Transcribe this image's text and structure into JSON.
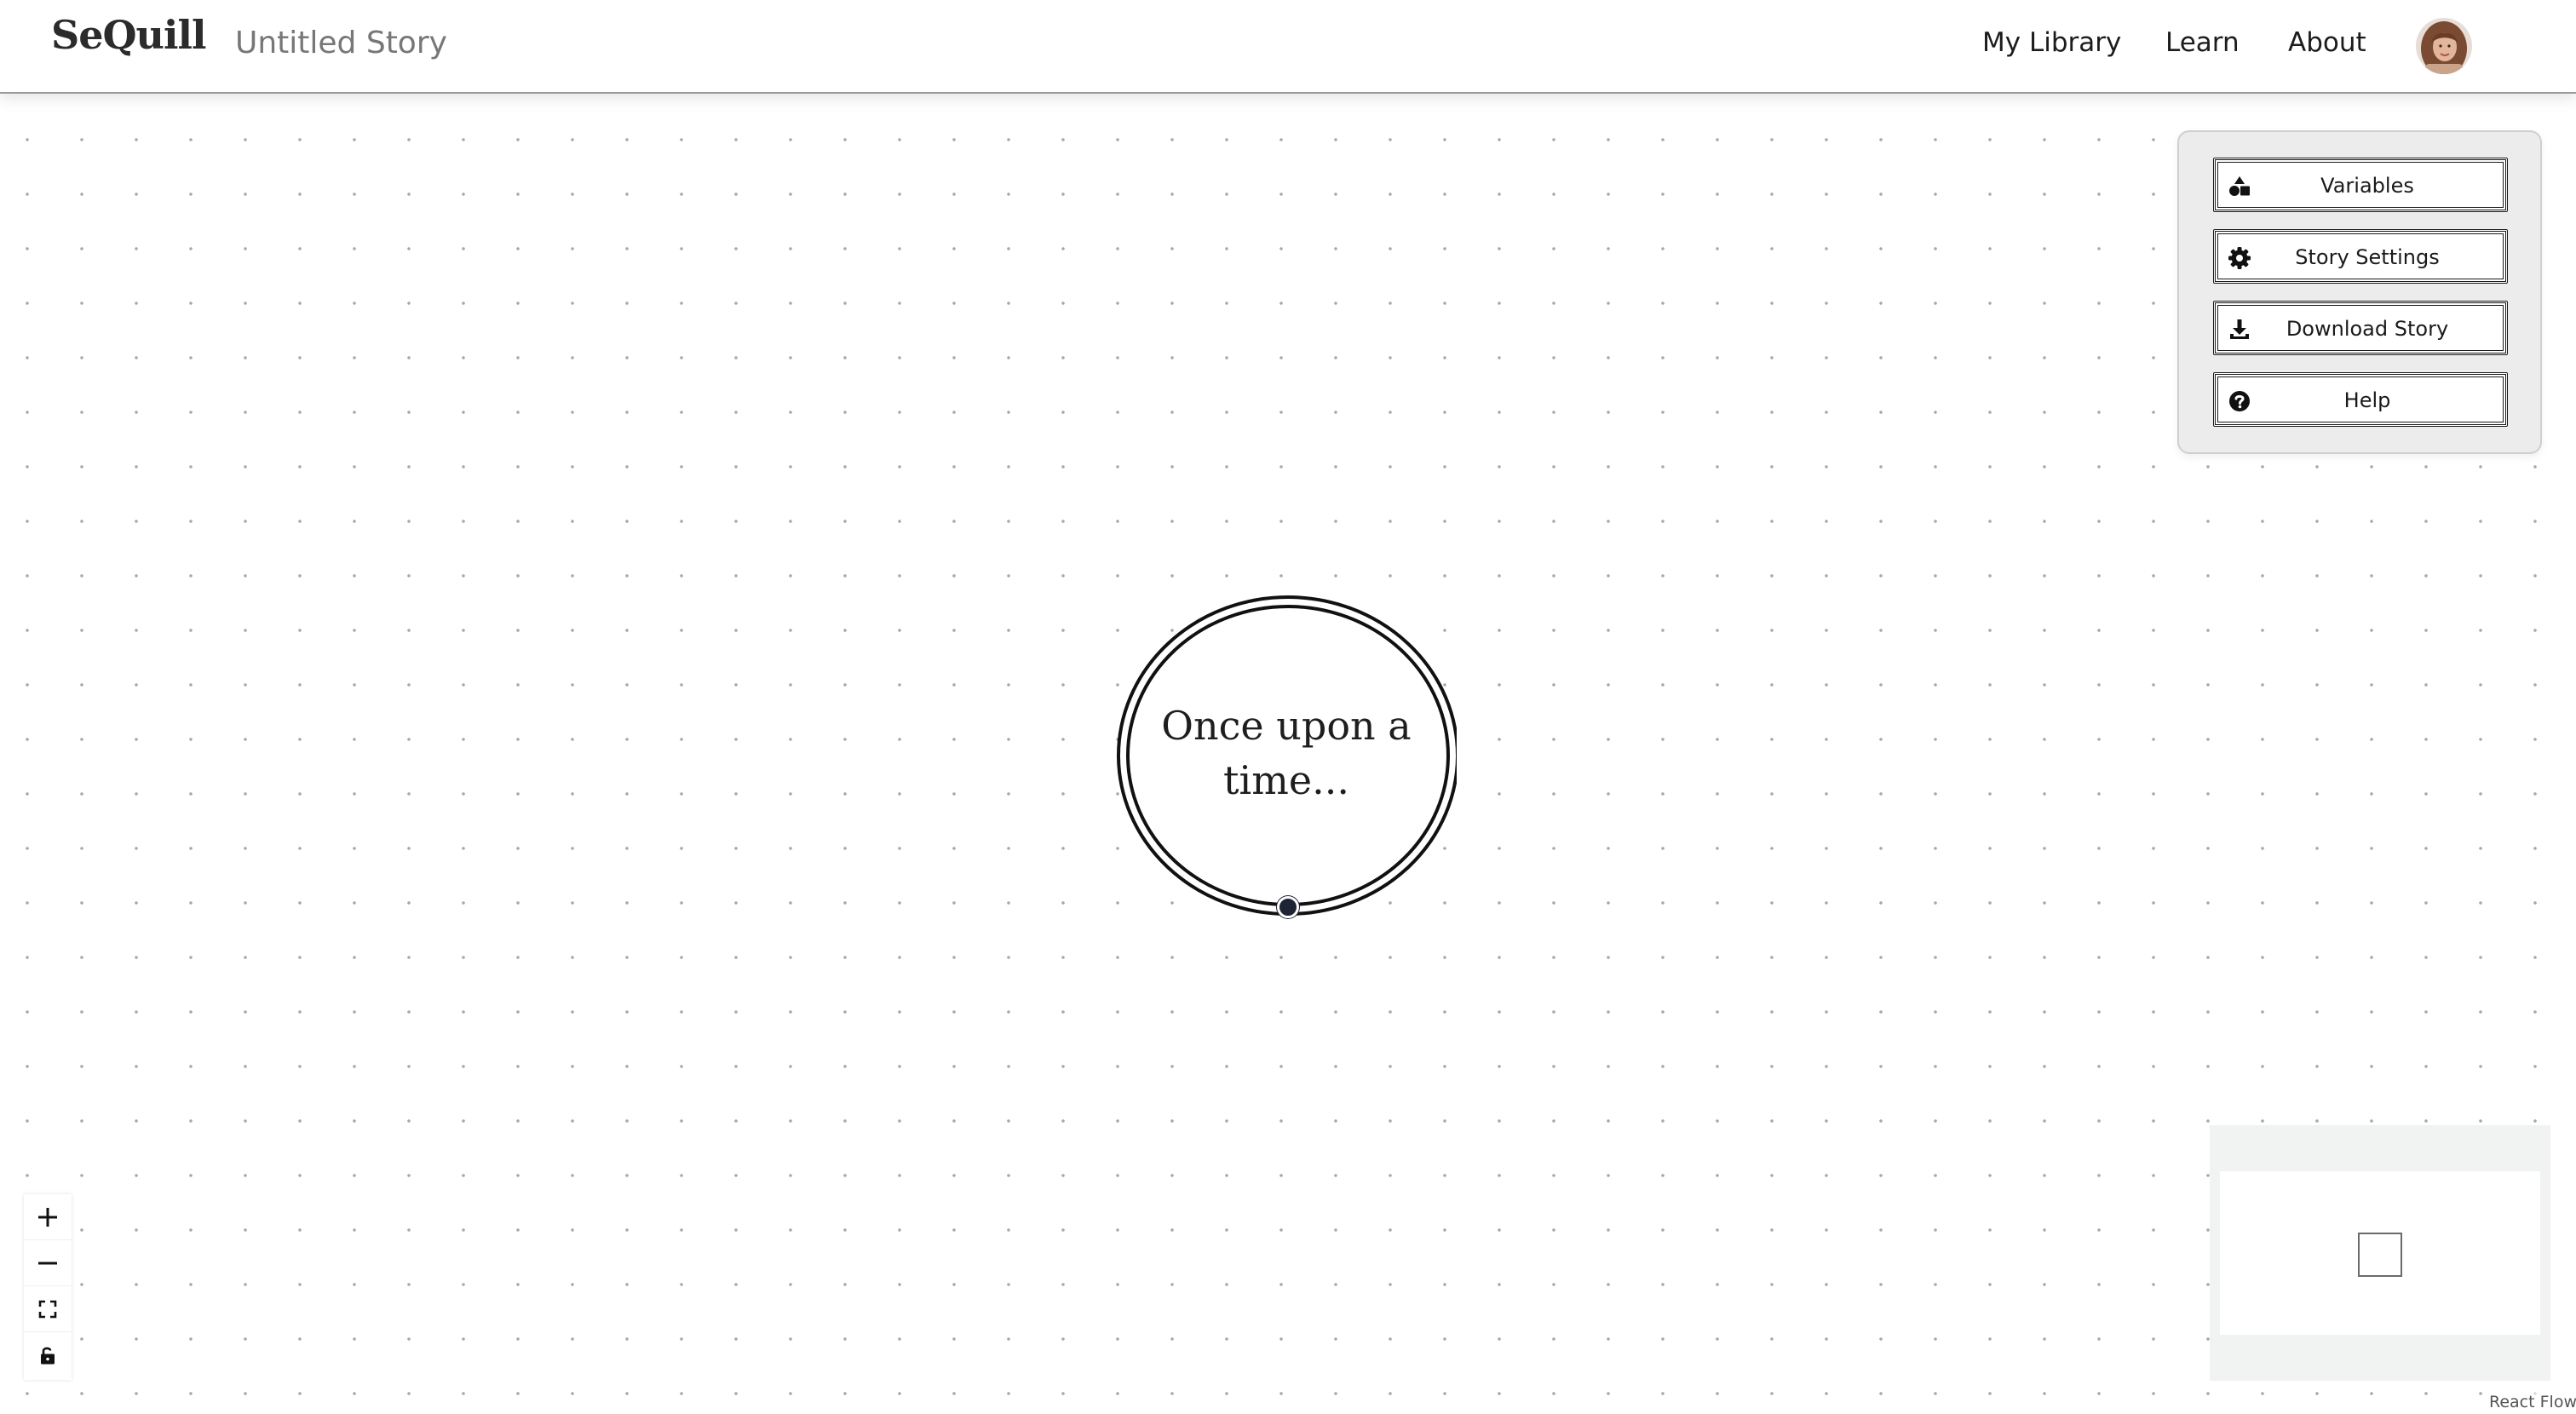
{
  "header": {
    "logo": "SeQuill",
    "story_title": "Untitled Story",
    "nav": {
      "my_library": "My Library",
      "learn": "Learn",
      "about": "About"
    }
  },
  "canvas": {
    "start_node": {
      "text": "Once upon a time..."
    }
  },
  "tool_panel": {
    "variables": {
      "label": "Variables",
      "icon": "shapes-icon"
    },
    "story_settings": {
      "label": "Story Settings",
      "icon": "gear-icon"
    },
    "download_story": {
      "label": "Download Story",
      "icon": "download-icon"
    },
    "help": {
      "label": "Help",
      "icon": "question-circle-icon"
    }
  },
  "controls": {
    "zoom_in": "plus-icon",
    "zoom_out": "minus-icon",
    "fit_view": "fit-view-icon",
    "lock": "lock-icon"
  },
  "attribution": "React Flow",
  "colors": {
    "handle": "#1d2433",
    "panel_background": "#ececed",
    "minimap_background": "#f1f2f2"
  }
}
